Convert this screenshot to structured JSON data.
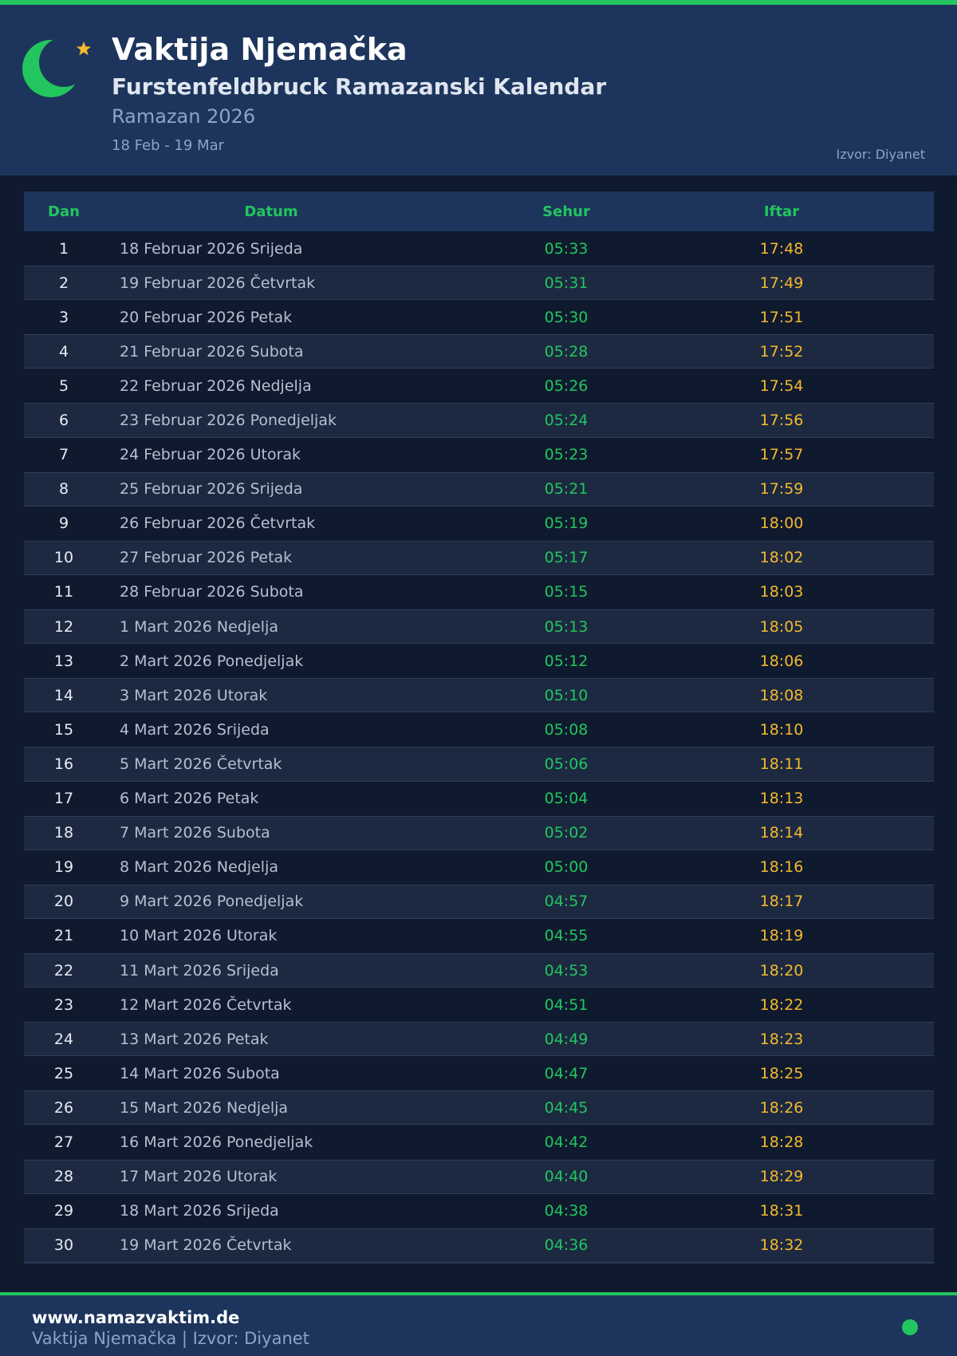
{
  "header": {
    "title": "Vaktija Njemačka",
    "subtitle": "Furstenfeldbruck Ramazanski Kalendar",
    "ramazan": "Ramazan 2026",
    "range": "18 Feb - 19 Mar",
    "source": "Izvor: Diyanet"
  },
  "icons": {
    "logo": "crescent-moon-icon",
    "star": "star-icon",
    "dot": "status-dot-icon"
  },
  "colors": {
    "accent_green": "#22c55e",
    "iftar_orange": "#f5b82e",
    "header_bg": "#1d355c",
    "page_bg": "#0f1a2e"
  },
  "table": {
    "headers": {
      "dan": "Dan",
      "datum": "Datum",
      "sehur": "Sehur",
      "iftar": "Iftar"
    },
    "rows": [
      {
        "dan": "1",
        "datum": "18 Februar 2026 Srijeda",
        "sehur": "05:33",
        "iftar": "17:48"
      },
      {
        "dan": "2",
        "datum": "19 Februar 2026 Četvrtak",
        "sehur": "05:31",
        "iftar": "17:49"
      },
      {
        "dan": "3",
        "datum": "20 Februar 2026 Petak",
        "sehur": "05:30",
        "iftar": "17:51"
      },
      {
        "dan": "4",
        "datum": "21 Februar 2026 Subota",
        "sehur": "05:28",
        "iftar": "17:52"
      },
      {
        "dan": "5",
        "datum": "22 Februar 2026 Nedjelja",
        "sehur": "05:26",
        "iftar": "17:54"
      },
      {
        "dan": "6",
        "datum": "23 Februar 2026 Ponedjeljak",
        "sehur": "05:24",
        "iftar": "17:56"
      },
      {
        "dan": "7",
        "datum": "24 Februar 2026 Utorak",
        "sehur": "05:23",
        "iftar": "17:57"
      },
      {
        "dan": "8",
        "datum": "25 Februar 2026 Srijeda",
        "sehur": "05:21",
        "iftar": "17:59"
      },
      {
        "dan": "9",
        "datum": "26 Februar 2026 Četvrtak",
        "sehur": "05:19",
        "iftar": "18:00"
      },
      {
        "dan": "10",
        "datum": "27 Februar 2026 Petak",
        "sehur": "05:17",
        "iftar": "18:02"
      },
      {
        "dan": "11",
        "datum": "28 Februar 2026 Subota",
        "sehur": "05:15",
        "iftar": "18:03"
      },
      {
        "dan": "12",
        "datum": "1 Mart 2026 Nedjelja",
        "sehur": "05:13",
        "iftar": "18:05"
      },
      {
        "dan": "13",
        "datum": "2 Mart 2026 Ponedjeljak",
        "sehur": "05:12",
        "iftar": "18:06"
      },
      {
        "dan": "14",
        "datum": "3 Mart 2026 Utorak",
        "sehur": "05:10",
        "iftar": "18:08"
      },
      {
        "dan": "15",
        "datum": "4 Mart 2026 Srijeda",
        "sehur": "05:08",
        "iftar": "18:10"
      },
      {
        "dan": "16",
        "datum": "5 Mart 2026 Četvrtak",
        "sehur": "05:06",
        "iftar": "18:11"
      },
      {
        "dan": "17",
        "datum": "6 Mart 2026 Petak",
        "sehur": "05:04",
        "iftar": "18:13"
      },
      {
        "dan": "18",
        "datum": "7 Mart 2026 Subota",
        "sehur": "05:02",
        "iftar": "18:14"
      },
      {
        "dan": "19",
        "datum": "8 Mart 2026 Nedjelja",
        "sehur": "05:00",
        "iftar": "18:16"
      },
      {
        "dan": "20",
        "datum": "9 Mart 2026 Ponedjeljak",
        "sehur": "04:57",
        "iftar": "18:17"
      },
      {
        "dan": "21",
        "datum": "10 Mart 2026 Utorak",
        "sehur": "04:55",
        "iftar": "18:19"
      },
      {
        "dan": "22",
        "datum": "11 Mart 2026 Srijeda",
        "sehur": "04:53",
        "iftar": "18:20"
      },
      {
        "dan": "23",
        "datum": "12 Mart 2026 Četvrtak",
        "sehur": "04:51",
        "iftar": "18:22"
      },
      {
        "dan": "24",
        "datum": "13 Mart 2026 Petak",
        "sehur": "04:49",
        "iftar": "18:23"
      },
      {
        "dan": "25",
        "datum": "14 Mart 2026 Subota",
        "sehur": "04:47",
        "iftar": "18:25"
      },
      {
        "dan": "26",
        "datum": "15 Mart 2026 Nedjelja",
        "sehur": "04:45",
        "iftar": "18:26"
      },
      {
        "dan": "27",
        "datum": "16 Mart 2026 Ponedjeljak",
        "sehur": "04:42",
        "iftar": "18:28"
      },
      {
        "dan": "28",
        "datum": "17 Mart 2026 Utorak",
        "sehur": "04:40",
        "iftar": "18:29"
      },
      {
        "dan": "29",
        "datum": "18 Mart 2026 Srijeda",
        "sehur": "04:38",
        "iftar": "18:31"
      },
      {
        "dan": "30",
        "datum": "19 Mart 2026 Četvrtak",
        "sehur": "04:36",
        "iftar": "18:32"
      }
    ]
  },
  "footer": {
    "url": "www.namazvaktim.de",
    "subtitle": "Vaktija Njemačka | Izvor: Diyanet"
  }
}
